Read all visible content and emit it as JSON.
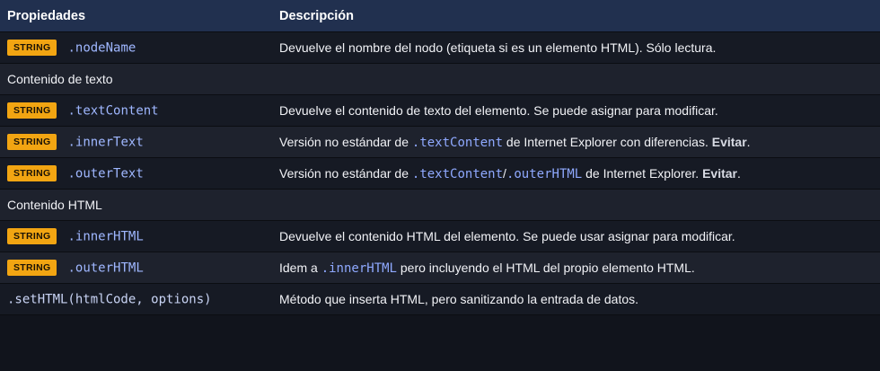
{
  "header": {
    "col_properties": "Propiedades",
    "col_description": "Descripción"
  },
  "badge_label": "STRING",
  "rows": {
    "nodeName": {
      "prop": ".nodeName",
      "desc": "Devuelve el nombre del nodo (etiqueta si es un elemento HTML). Sólo lectura."
    },
    "section_text": "Contenido de texto",
    "textContent": {
      "prop": ".textContent",
      "desc": "Devuelve el contenido de texto del elemento. Se puede asignar para modificar."
    },
    "innerText": {
      "prop": ".innerText",
      "desc_a": "Versión no estándar de ",
      "desc_code": ".textContent",
      "desc_b": " de Internet Explorer con diferencias. ",
      "desc_strong": "Evitar",
      "desc_end": "."
    },
    "outerText": {
      "prop": ".outerText",
      "desc_a": "Versión no estándar de ",
      "desc_code1": ".textContent",
      "desc_sep": "/",
      "desc_code2": ".outerHTML",
      "desc_b": " de Internet Explorer. ",
      "desc_strong": "Evitar",
      "desc_end": "."
    },
    "section_html": "Contenido HTML",
    "innerHTML": {
      "prop": ".innerHTML",
      "desc": "Devuelve el contenido HTML del elemento. Se puede usar asignar para modificar."
    },
    "outerHTML": {
      "prop": ".outerHTML",
      "desc_a": "Idem a ",
      "desc_code": ".innerHTML",
      "desc_b": " pero incluyendo el HTML del propio elemento HTML."
    },
    "setHTML": {
      "prop": ".setHTML(htmlCode, options)",
      "desc": "Método que inserta HTML, pero sanitizando la entrada de datos."
    }
  },
  "colors": {
    "header_bg": "#21304f",
    "badge_bg": "#f2a512",
    "code_color": "#9fb7ff"
  }
}
